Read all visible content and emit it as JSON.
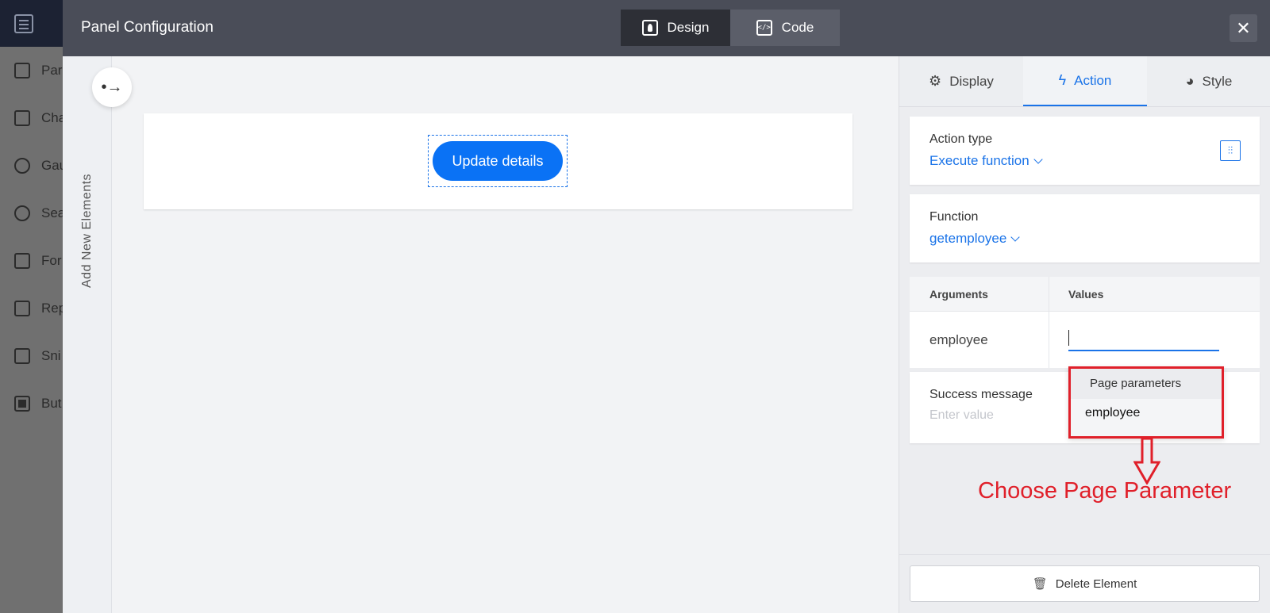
{
  "background_sidebar": {
    "items": [
      {
        "label": "Par",
        "icon": "page-icon"
      },
      {
        "label": "Cha",
        "icon": "chart-icon"
      },
      {
        "label": "Gau",
        "icon": "gauge-icon"
      },
      {
        "label": "Sea",
        "icon": "search-icon"
      },
      {
        "label": "For",
        "icon": "form-icon"
      },
      {
        "label": "Rep",
        "icon": "grid-icon"
      },
      {
        "label": "Sni",
        "icon": "snippet-icon"
      },
      {
        "label": "But",
        "icon": "button-icon"
      }
    ]
  },
  "header": {
    "title": "Panel Configuration",
    "design_label": "Design",
    "code_label": "Code",
    "close_glyph": "✕"
  },
  "rail": {
    "label": "Add New Elements",
    "toggle_glyph": "•→"
  },
  "canvas": {
    "button_label": "Update details"
  },
  "tabs": {
    "display": "Display",
    "action": "Action",
    "style": "Style",
    "active": "Action"
  },
  "action": {
    "type_label": "Action type",
    "type_value": "Execute function",
    "function_label": "Function",
    "function_value": "getemployee"
  },
  "arguments": {
    "col_arguments": "Arguments",
    "col_values": "Values",
    "rows": [
      {
        "name": "employee",
        "value": ""
      }
    ]
  },
  "success": {
    "label": "Success message",
    "placeholder": "Enter value"
  },
  "dropdown": {
    "header": "Page parameters",
    "items": [
      "employee"
    ]
  },
  "annotation": {
    "text": "Choose Page Parameter",
    "color": "#e0202a"
  },
  "footer": {
    "delete_label": "Delete Element"
  },
  "colors": {
    "accent": "#1a73e8",
    "primary_button": "#0a72f5",
    "header_bg": "#4a4d58"
  }
}
